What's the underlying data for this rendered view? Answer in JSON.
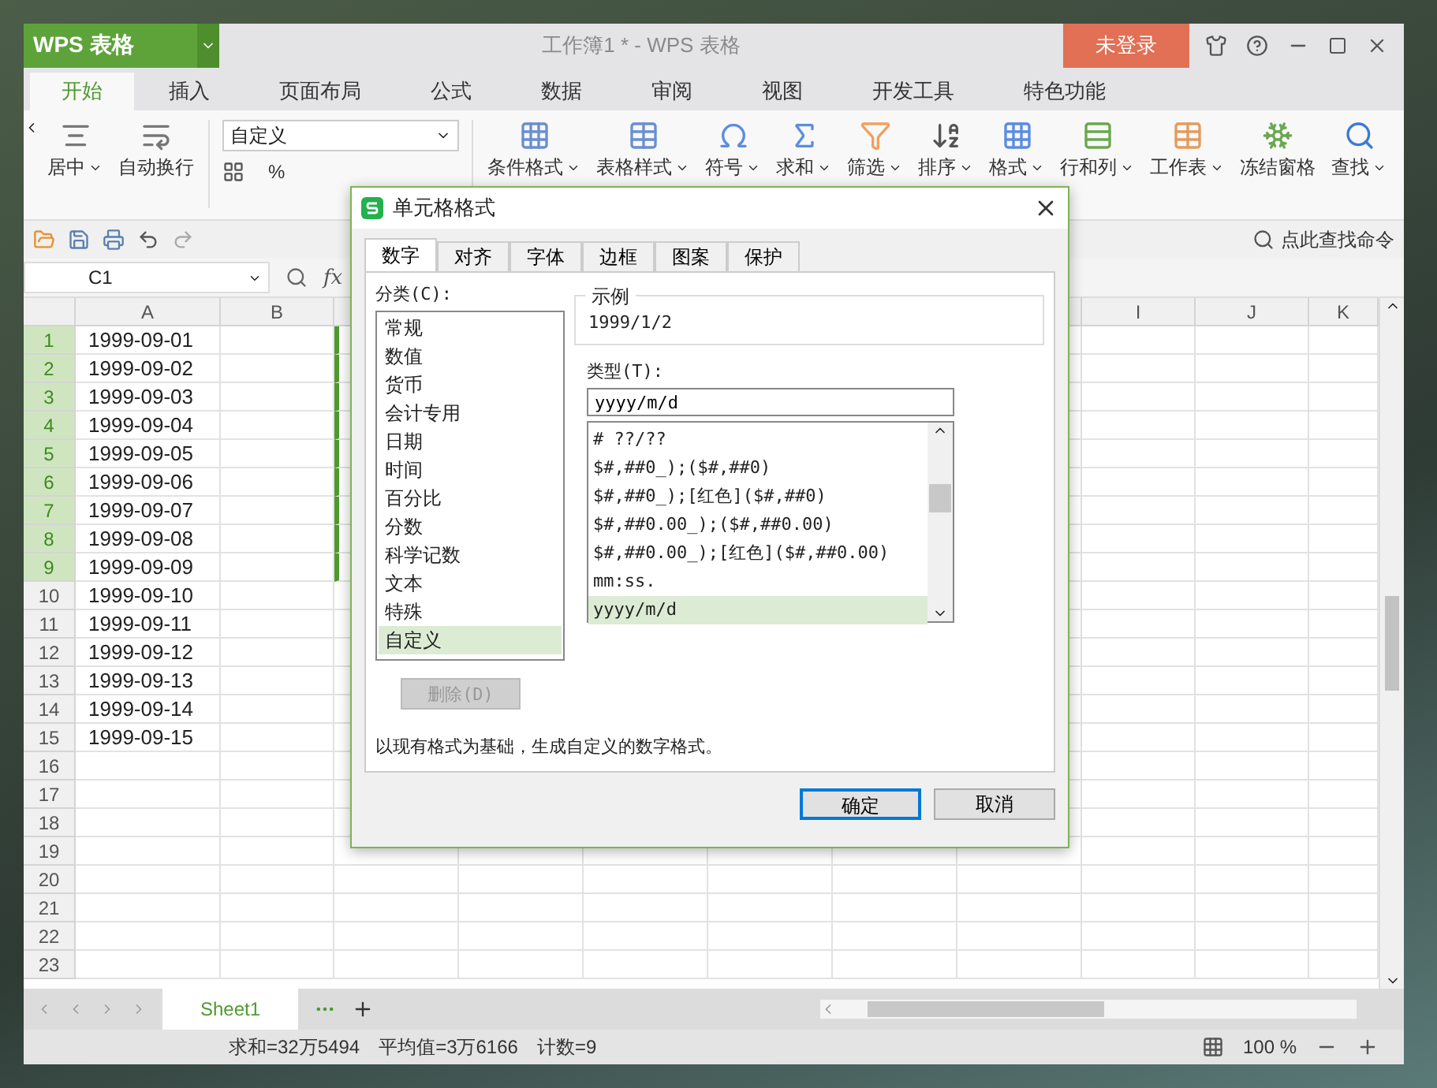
{
  "app_button": {
    "label": "WPS 表格"
  },
  "window": {
    "title": "工作簿1 * - WPS 表格"
  },
  "login_button": {
    "label": "未登录"
  },
  "menu_tabs": [
    {
      "label": "开始",
      "selected": true
    },
    {
      "label": "插入",
      "selected": false
    },
    {
      "label": "页面布局",
      "selected": false
    },
    {
      "label": "公式",
      "selected": false
    },
    {
      "label": "数据",
      "selected": false
    },
    {
      "label": "审阅",
      "selected": false
    },
    {
      "label": "视图",
      "selected": false
    },
    {
      "label": "开发工具",
      "selected": false
    },
    {
      "label": "特色功能",
      "selected": false
    }
  ],
  "ribbon": {
    "left_items": [
      {
        "label": "居中",
        "kind": "dropdown"
      },
      {
        "label": "自动换行",
        "kind": "button"
      }
    ],
    "number_format": "自定义",
    "number_buttons": [
      "%"
    ],
    "right_items": [
      {
        "label": "条件格式",
        "kind": "dropdown"
      },
      {
        "label": "表格样式",
        "kind": "dropdown"
      },
      {
        "label": "符号",
        "kind": "dropdown"
      },
      {
        "label": "求和",
        "kind": "dropdown"
      },
      {
        "label": "筛选",
        "kind": "dropdown"
      },
      {
        "label": "排序",
        "kind": "dropdown"
      },
      {
        "label": "格式",
        "kind": "dropdown"
      },
      {
        "label": "行和列",
        "kind": "dropdown"
      },
      {
        "label": "工作表",
        "kind": "dropdown"
      },
      {
        "label": "冻结窗格",
        "kind": "button"
      },
      {
        "label": "查找",
        "kind": "dropdown"
      }
    ]
  },
  "command_search": {
    "placeholder": "点此查找命令"
  },
  "name_box": {
    "value": "C1"
  },
  "formula_label": "fx",
  "sheet": {
    "columns": [
      "A",
      "B",
      "I",
      "J",
      "K"
    ],
    "rows": [
      {
        "header": "1",
        "selected": true,
        "cells": [
          "1999-09-01"
        ]
      },
      {
        "header": "2",
        "selected": true,
        "cells": [
          "1999-09-02"
        ]
      },
      {
        "header": "3",
        "selected": true,
        "cells": [
          "1999-09-03"
        ]
      },
      {
        "header": "4",
        "selected": true,
        "cells": [
          "1999-09-04"
        ]
      },
      {
        "header": "5",
        "selected": true,
        "cells": [
          "1999-09-05"
        ]
      },
      {
        "header": "6",
        "selected": true,
        "cells": [
          "1999-09-06"
        ]
      },
      {
        "header": "7",
        "selected": true,
        "cells": [
          "1999-09-07"
        ]
      },
      {
        "header": "8",
        "selected": true,
        "cells": [
          "1999-09-08"
        ]
      },
      {
        "header": "9",
        "selected": true,
        "cells": [
          "1999-09-09"
        ]
      },
      {
        "header": "10",
        "selected": false,
        "cells": [
          "1999-09-10"
        ]
      },
      {
        "header": "11",
        "selected": false,
        "cells": [
          "1999-09-11"
        ]
      },
      {
        "header": "12",
        "selected": false,
        "cells": [
          "1999-09-12"
        ]
      },
      {
        "header": "13",
        "selected": false,
        "cells": [
          "1999-09-13"
        ]
      },
      {
        "header": "14",
        "selected": false,
        "cells": [
          "1999-09-14"
        ]
      },
      {
        "header": "15",
        "selected": false,
        "cells": [
          "1999-09-15"
        ]
      },
      {
        "header": "16",
        "selected": false,
        "cells": []
      },
      {
        "header": "17",
        "selected": false,
        "cells": []
      },
      {
        "header": "18",
        "selected": false,
        "cells": []
      },
      {
        "header": "19",
        "selected": false,
        "cells": []
      },
      {
        "header": "20",
        "selected": false,
        "cells": []
      },
      {
        "header": "21",
        "selected": false,
        "cells": []
      },
      {
        "header": "22",
        "selected": false,
        "cells": []
      },
      {
        "header": "23",
        "selected": false,
        "cells": []
      }
    ]
  },
  "sheet_tabs": [
    {
      "label": "Sheet1",
      "selected": true
    }
  ],
  "status_bar": {
    "sum": "求和=32万5494",
    "average": "平均值=3万6166",
    "count": "计数=9",
    "zoom": "100 %"
  },
  "dialog": {
    "title": "单元格格式",
    "tabs": [
      {
        "label": "数字",
        "selected": true
      },
      {
        "label": "对齐",
        "selected": false
      },
      {
        "label": "字体",
        "selected": false
      },
      {
        "label": "边框",
        "selected": false
      },
      {
        "label": "图案",
        "selected": false
      },
      {
        "label": "保护",
        "selected": false
      }
    ],
    "category_label": "分类(C):",
    "categories": [
      {
        "label": "常规",
        "selected": false
      },
      {
        "label": "数值",
        "selected": false
      },
      {
        "label": "货币",
        "selected": false
      },
      {
        "label": "会计专用",
        "selected": false
      },
      {
        "label": "日期",
        "selected": false
      },
      {
        "label": "时间",
        "selected": false
      },
      {
        "label": "百分比",
        "selected": false
      },
      {
        "label": "分数",
        "selected": false
      },
      {
        "label": "科学记数",
        "selected": false
      },
      {
        "label": "文本",
        "selected": false
      },
      {
        "label": "特殊",
        "selected": false
      },
      {
        "label": "自定义",
        "selected": true
      }
    ],
    "delete_button": {
      "label": "删除(D)",
      "disabled": true
    },
    "sample_label": "示例",
    "sample_value": "1999/1/2",
    "type_label": "类型(T):",
    "type_value": "yyyy/m/d",
    "formats": [
      {
        "label": "# ??/??",
        "selected": false
      },
      {
        "label": "$#,##0_);($#,##0)",
        "selected": false
      },
      {
        "label": "$#,##0_);[红色]($#,##0)",
        "selected": false
      },
      {
        "label": "$#,##0.00_);($#,##0.00)",
        "selected": false
      },
      {
        "label": "$#,##0.00_);[红色]($#,##0.00)",
        "selected": false
      },
      {
        "label": "mm:ss.",
        "selected": false
      },
      {
        "label": "yyyy/m/d",
        "selected": true
      }
    ],
    "description": "以现有格式为基础，生成自定义的数字格式。",
    "ok_button": "确定",
    "cancel_button": "取消"
  }
}
